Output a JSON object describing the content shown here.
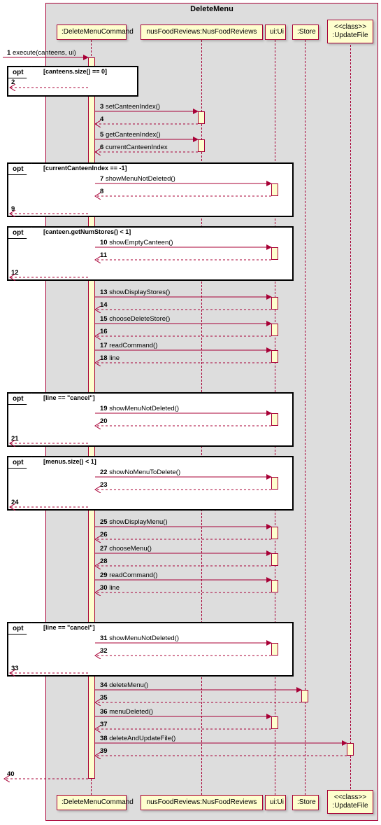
{
  "title": "DeleteMenu",
  "participants": {
    "p1": ":DeleteMenuCommand",
    "p2": "nusFoodReviews:NusFoodReviews",
    "p3": "ui:Ui",
    "p4": ":Store",
    "p5_top": "<<class>>",
    "p5_name": ":UpdateFile"
  },
  "messages": {
    "m1": "execute(canteens, ui)",
    "m3": "setCanteenIndex()",
    "m5": "getCanteenIndex()",
    "m6": "currentCanteenIndex",
    "m7": "showMenuNotDeleted()",
    "m10": "showEmptyCanteen()",
    "m13": "showDisplayStores()",
    "m15": "chooseDeleteStore()",
    "m17": "readCommand()",
    "m18": "line",
    "m19": "showMenuNotDeleted()",
    "m22": "showNoMenuToDelete()",
    "m25": "showDisplayMenu()",
    "m27": "chooseMenu()",
    "m29": "readCommand()",
    "m30": "line",
    "m31": "showMenuNotDeleted()",
    "m34": "deleteMenu()",
    "m36": "menuDeleted()",
    "m38": "deleteAndUpdateFile()"
  },
  "numbers": {
    "n1": "1",
    "n2": "2",
    "n3": "3",
    "n4": "4",
    "n5": "5",
    "n6": "6",
    "n7": "7",
    "n8": "8",
    "n9": "9",
    "n10": "10",
    "n11": "11",
    "n12": "12",
    "n13": "13",
    "n14": "14",
    "n15": "15",
    "n16": "16",
    "n17": "17",
    "n18": "18",
    "n19": "19",
    "n20": "20",
    "n21": "21",
    "n22": "22",
    "n23": "23",
    "n24": "24",
    "n25": "25",
    "n26": "26",
    "n27": "27",
    "n28": "28",
    "n29": "29",
    "n30": "30",
    "n31": "31",
    "n32": "32",
    "n33": "33",
    "n34": "34",
    "n35": "35",
    "n36": "36",
    "n37": "37",
    "n38": "38",
    "n39": "39",
    "n40": "40"
  },
  "guards": {
    "g1": "[canteens.size() == 0]",
    "g2": "[currentCanteenIndex == -1]",
    "g3": "[canteen.getNumStores() < 1]",
    "g4": "[line == \"cancel\"]",
    "g5": "[menus.size() < 1]",
    "g6": "[line == \"cancel\"]"
  },
  "opt_label": "opt",
  "chart_data": {
    "type": "uml-sequence-diagram",
    "frame": "DeleteMenu",
    "participants": [
      {
        "id": "cmd",
        "label": ":DeleteMenuCommand"
      },
      {
        "id": "nfr",
        "label": "nusFoodReviews:NusFoodReviews"
      },
      {
        "id": "ui",
        "label": "ui:Ui"
      },
      {
        "id": "store",
        "label": ":Store"
      },
      {
        "id": "uf",
        "stereotype": "<<class>>",
        "label": ":UpdateFile"
      }
    ],
    "external_actor": "caller",
    "messages": [
      {
        "n": 1,
        "from": "caller",
        "to": "cmd",
        "type": "sync",
        "label": "execute(canteens, ui)"
      },
      {
        "n": 2,
        "from": "cmd",
        "to": "caller",
        "type": "return",
        "label": ""
      },
      {
        "n": 3,
        "from": "cmd",
        "to": "nfr",
        "type": "sync",
        "label": "setCanteenIndex()"
      },
      {
        "n": 4,
        "from": "nfr",
        "to": "cmd",
        "type": "return",
        "label": ""
      },
      {
        "n": 5,
        "from": "cmd",
        "to": "nfr",
        "type": "sync",
        "label": "getCanteenIndex()"
      },
      {
        "n": 6,
        "from": "nfr",
        "to": "cmd",
        "type": "return",
        "label": "currentCanteenIndex"
      },
      {
        "n": 7,
        "from": "cmd",
        "to": "ui",
        "type": "sync",
        "label": "showMenuNotDeleted()"
      },
      {
        "n": 8,
        "from": "ui",
        "to": "cmd",
        "type": "return",
        "label": ""
      },
      {
        "n": 9,
        "from": "cmd",
        "to": "caller",
        "type": "return",
        "label": ""
      },
      {
        "n": 10,
        "from": "cmd",
        "to": "ui",
        "type": "sync",
        "label": "showEmptyCanteen()"
      },
      {
        "n": 11,
        "from": "ui",
        "to": "cmd",
        "type": "return",
        "label": ""
      },
      {
        "n": 12,
        "from": "cmd",
        "to": "caller",
        "type": "return",
        "label": ""
      },
      {
        "n": 13,
        "from": "cmd",
        "to": "ui",
        "type": "sync",
        "label": "showDisplayStores()"
      },
      {
        "n": 14,
        "from": "ui",
        "to": "cmd",
        "type": "return",
        "label": ""
      },
      {
        "n": 15,
        "from": "cmd",
        "to": "ui",
        "type": "sync",
        "label": "chooseDeleteStore()"
      },
      {
        "n": 16,
        "from": "ui",
        "to": "cmd",
        "type": "return",
        "label": ""
      },
      {
        "n": 17,
        "from": "cmd",
        "to": "ui",
        "type": "sync",
        "label": "readCommand()"
      },
      {
        "n": 18,
        "from": "ui",
        "to": "cmd",
        "type": "return",
        "label": "line"
      },
      {
        "n": 19,
        "from": "cmd",
        "to": "ui",
        "type": "sync",
        "label": "showMenuNotDeleted()"
      },
      {
        "n": 20,
        "from": "ui",
        "to": "cmd",
        "type": "return",
        "label": ""
      },
      {
        "n": 21,
        "from": "cmd",
        "to": "caller",
        "type": "return",
        "label": ""
      },
      {
        "n": 22,
        "from": "cmd",
        "to": "ui",
        "type": "sync",
        "label": "showNoMenuToDelete()"
      },
      {
        "n": 23,
        "from": "ui",
        "to": "cmd",
        "type": "return",
        "label": ""
      },
      {
        "n": 24,
        "from": "cmd",
        "to": "caller",
        "type": "return",
        "label": ""
      },
      {
        "n": 25,
        "from": "cmd",
        "to": "ui",
        "type": "sync",
        "label": "showDisplayMenu()"
      },
      {
        "n": 26,
        "from": "ui",
        "to": "cmd",
        "type": "return",
        "label": ""
      },
      {
        "n": 27,
        "from": "cmd",
        "to": "ui",
        "type": "sync",
        "label": "chooseMenu()"
      },
      {
        "n": 28,
        "from": "ui",
        "to": "cmd",
        "type": "return",
        "label": ""
      },
      {
        "n": 29,
        "from": "cmd",
        "to": "ui",
        "type": "sync",
        "label": "readCommand()"
      },
      {
        "n": 30,
        "from": "ui",
        "to": "cmd",
        "type": "return",
        "label": "line"
      },
      {
        "n": 31,
        "from": "cmd",
        "to": "ui",
        "type": "sync",
        "label": "showMenuNotDeleted()"
      },
      {
        "n": 32,
        "from": "ui",
        "to": "cmd",
        "type": "return",
        "label": ""
      },
      {
        "n": 33,
        "from": "cmd",
        "to": "caller",
        "type": "return",
        "label": ""
      },
      {
        "n": 34,
        "from": "cmd",
        "to": "store",
        "type": "sync",
        "label": "deleteMenu()"
      },
      {
        "n": 35,
        "from": "store",
        "to": "cmd",
        "type": "return",
        "label": ""
      },
      {
        "n": 36,
        "from": "cmd",
        "to": "ui",
        "type": "sync",
        "label": "menuDeleted()"
      },
      {
        "n": 37,
        "from": "ui",
        "to": "cmd",
        "type": "return",
        "label": ""
      },
      {
        "n": 38,
        "from": "cmd",
        "to": "uf",
        "type": "sync",
        "label": "deleteAndUpdateFile()"
      },
      {
        "n": 39,
        "from": "uf",
        "to": "cmd",
        "type": "return",
        "label": ""
      },
      {
        "n": 40,
        "from": "cmd",
        "to": "caller",
        "type": "return",
        "label": ""
      }
    ],
    "fragments": [
      {
        "type": "opt",
        "guard": "[canteens.size() == 0]",
        "covers_messages": [
          2
        ]
      },
      {
        "type": "opt",
        "guard": "[currentCanteenIndex == -1]",
        "covers_messages": [
          7,
          8,
          9
        ]
      },
      {
        "type": "opt",
        "guard": "[canteen.getNumStores() < 1]",
        "covers_messages": [
          10,
          11,
          12
        ]
      },
      {
        "type": "opt",
        "guard": "[line == \"cancel\"]",
        "covers_messages": [
          19,
          20,
          21
        ]
      },
      {
        "type": "opt",
        "guard": "[menus.size() < 1]",
        "covers_messages": [
          22,
          23,
          24
        ]
      },
      {
        "type": "opt",
        "guard": "[line == \"cancel\"]",
        "covers_messages": [
          31,
          32,
          33
        ]
      }
    ]
  }
}
